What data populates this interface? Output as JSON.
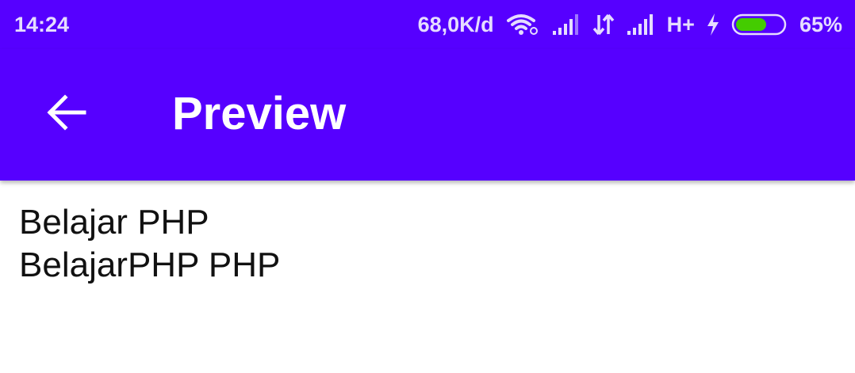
{
  "colors": {
    "primary": "#5600ff",
    "status_text": "#e6dcff",
    "battery_fill": "#44cc00",
    "content_text": "#111111"
  },
  "status_bar": {
    "time": "14:24",
    "network_speed": "68,0K/d",
    "network_type": "H+",
    "battery_percent": "65%",
    "battery_level": 0.65,
    "icons": [
      "wifi-icon",
      "signal-icon",
      "data-transfer-icon",
      "signal-icon",
      "charging-icon",
      "battery-icon"
    ]
  },
  "app_bar": {
    "back_icon": "arrow-left-icon",
    "title": "Preview"
  },
  "content": {
    "lines": [
      "Belajar PHP",
      "BelajarPHP PHP"
    ]
  }
}
